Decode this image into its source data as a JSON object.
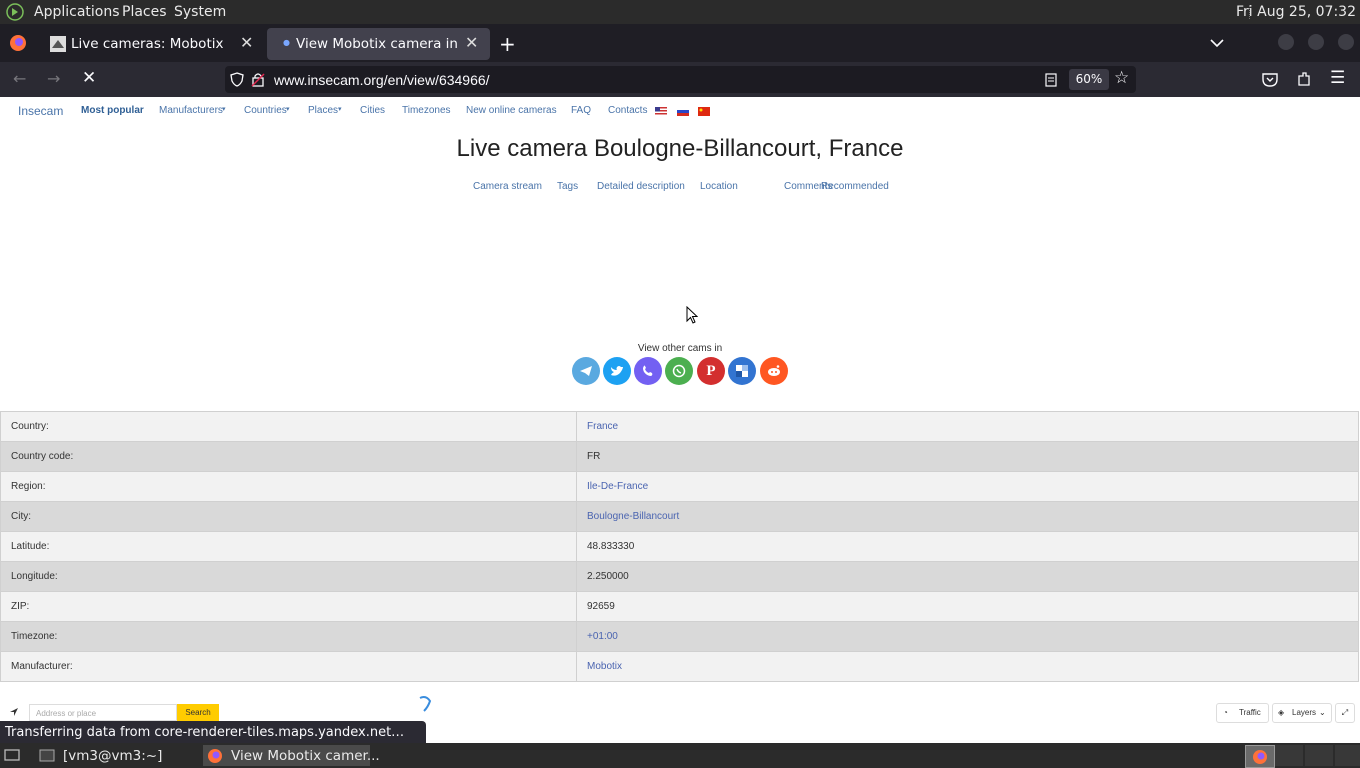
{
  "panel": {
    "menus": [
      "Applications",
      "Places",
      "System"
    ],
    "clock": "Fri Aug 25, 07:32"
  },
  "browser": {
    "tabs": [
      {
        "title": "Live cameras: Mobotix"
      },
      {
        "title": "View Mobotix camera in Fra"
      }
    ],
    "url": "www.insecam.org/en/view/634966/",
    "zoom": "60%",
    "status": "Transferring data from core-renderer-tiles.maps.yandex.net…"
  },
  "site": {
    "brand": "Insecam",
    "nav": [
      "Most popular",
      "Manufacturers",
      "Countries",
      "Places",
      "Cities",
      "Timezones",
      "New online cameras",
      "FAQ",
      "Contacts"
    ],
    "title": "Live camera Boulogne-Billancourt, France",
    "subnav": [
      "Camera stream",
      "Tags",
      "Detailed description",
      "Location",
      "Comments",
      "Recommended"
    ],
    "share_label": "View other cams in",
    "share_icons": [
      "telegram-icon",
      "twitter-icon",
      "viber-icon",
      "whatsapp-icon",
      "pinterest-icon",
      "delicious-icon",
      "reddit-icon"
    ],
    "info": {
      "country_label": "Country:",
      "country": "France",
      "code_label": "Country code:",
      "code": "FR",
      "region_label": "Region:",
      "region": "Ile-De-France",
      "city_label": "City:",
      "city": "Boulogne-Billancourt",
      "lat_label": "Latitude:",
      "lat": "48.833330",
      "lon_label": "Longitude:",
      "lon": "2.250000",
      "zip_label": "ZIP:",
      "zip": "92659",
      "tz_label": "Timezone:",
      "tz": "+01:00",
      "mfr_label": "Manufacturer:",
      "mfr": "Mobotix"
    },
    "map": {
      "placeholder": "Address or place",
      "search": "Search",
      "traffic": "Traffic",
      "layers": "Layers"
    }
  },
  "taskbar": {
    "items": [
      "[vm3@vm3:~]",
      "View Mobotix camer..."
    ]
  },
  "colors": {
    "link": "#4a74a9",
    "accent_share": [
      "#5aa9e0",
      "#1da1f2",
      "#7360f2",
      "#4caf50",
      "#d32f2f",
      "#3274d1",
      "#ff5722"
    ]
  }
}
